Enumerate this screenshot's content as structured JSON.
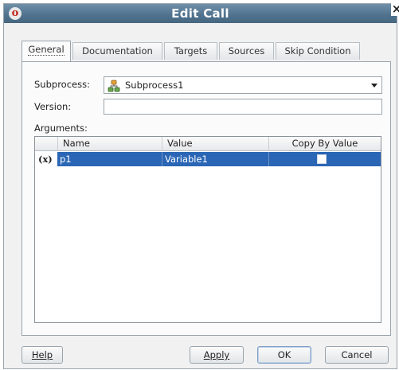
{
  "window": {
    "title": "Edit Call",
    "app_icon_glyph": "o",
    "close_glyph": "×"
  },
  "tabs": [
    {
      "label": "General",
      "active": true
    },
    {
      "label": "Documentation",
      "active": false
    },
    {
      "label": "Targets",
      "active": false
    },
    {
      "label": "Sources",
      "active": false
    },
    {
      "label": "Skip Condition",
      "active": false
    }
  ],
  "form": {
    "subprocess_label": "Subprocess:",
    "subprocess_value": "Subprocess1",
    "subprocess_icon": "subprocess-icon",
    "version_label": "Version:",
    "version_value": "",
    "arguments_label": "Arguments:"
  },
  "arguments_table": {
    "columns": [
      "Name",
      "Value",
      "Copy By Value"
    ],
    "rows": [
      {
        "row_marker": "(x)",
        "name": "p1",
        "value": "Variable1",
        "copy_by_value": false,
        "selected": true
      }
    ]
  },
  "buttons": {
    "help": "Help",
    "apply": "Apply",
    "ok": "OK",
    "cancel": "Cancel"
  },
  "colors": {
    "titlebar": "#4f718d",
    "selection": "#2a66b5",
    "app_icon_red": "#c3271f"
  }
}
